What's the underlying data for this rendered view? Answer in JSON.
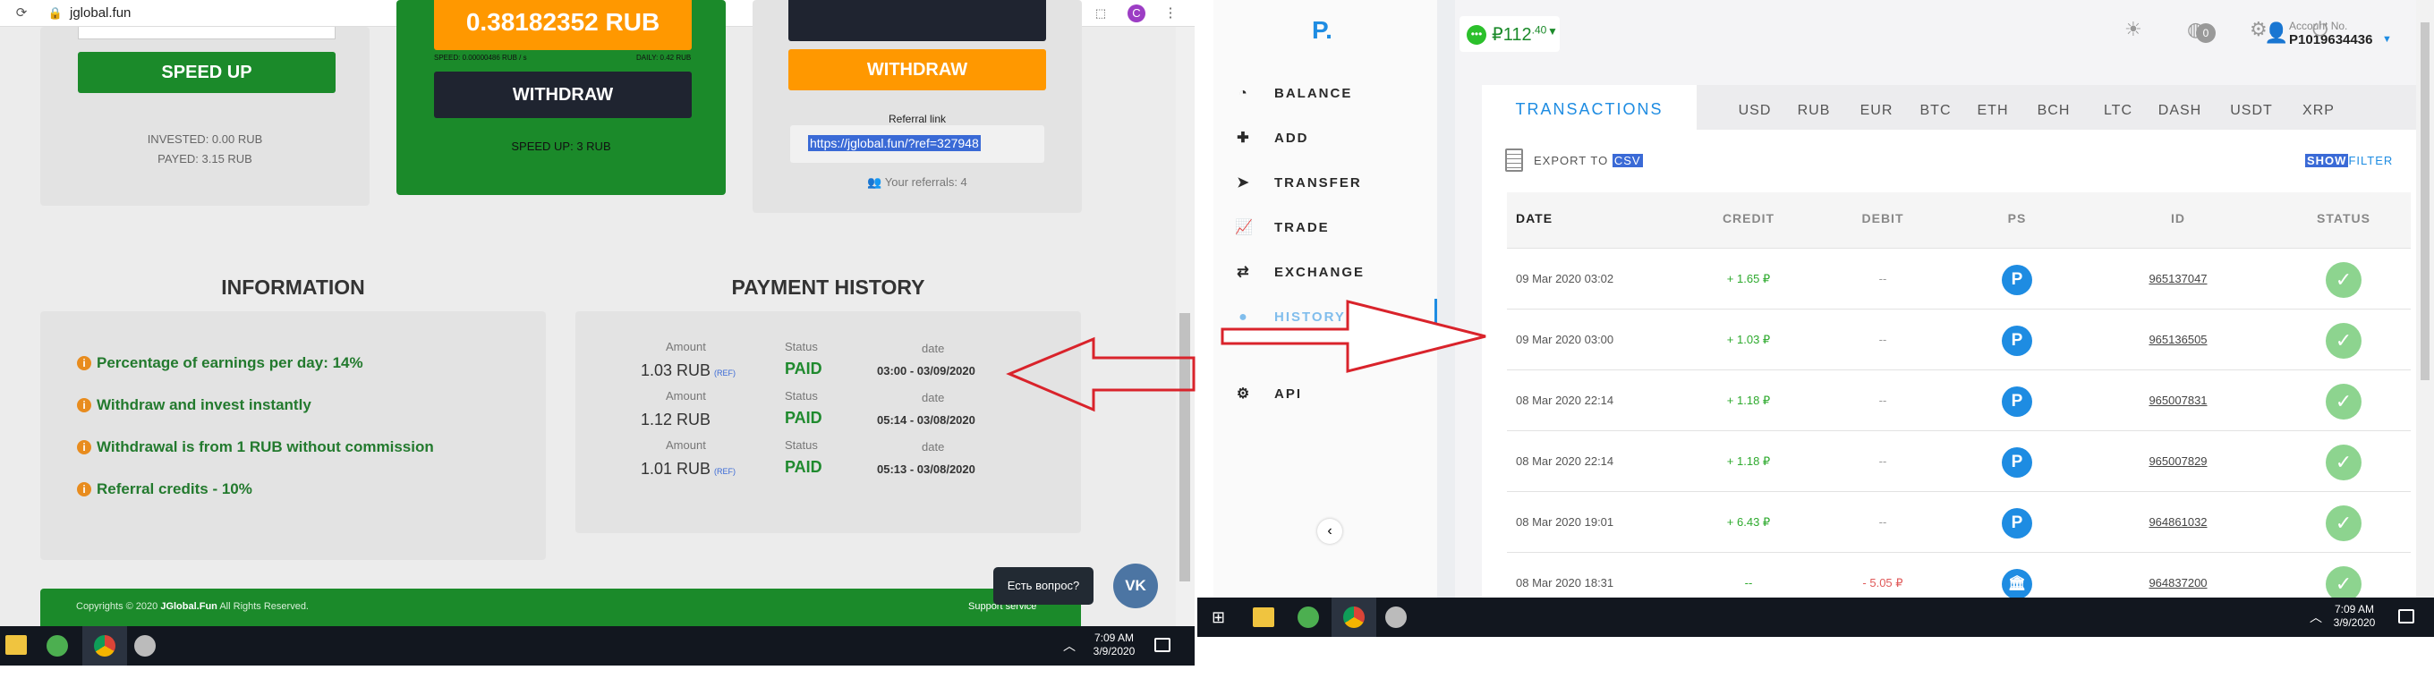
{
  "left": {
    "url": "jglobal.fun",
    "invest_card": {
      "speed_up_label": "SPEED UP",
      "invested": "INVESTED: 0.00 RUB",
      "payed": "PAYED: 3.15 RUB"
    },
    "green_card": {
      "balance": "0.38182352 RUB",
      "speed_line": "SPEED: 0.00000486 RUB / s",
      "daily_line": "DAILY: 0.42 RUB",
      "withdraw_label": "WITHDRAW",
      "speed_up_count": "SPEED UP: 3 RUB"
    },
    "ref_card": {
      "withdraw_label": "WITHDRAW",
      "referral_link_title": "Referral link",
      "referral_link": "https://jglobal.fun/?ref=327948",
      "referrals": "Your referrals: 4"
    },
    "information": {
      "title": "INFORMATION",
      "items": [
        "Percentage of earnings per day: 14%",
        "Withdraw and invest instantly",
        "Withdrawal is from 1 RUB without commission",
        "Referral credits - 10%"
      ]
    },
    "payment_history": {
      "title": "PAYMENT HISTORY",
      "amount_label": "Amount",
      "status_label": "Status",
      "date_label": "date",
      "rows": [
        {
          "amount": "1.03 RUB",
          "ref": "(REF)",
          "status": "PAID",
          "date": "03:00 - 03/09/2020"
        },
        {
          "amount": "1.12 RUB",
          "ref": "",
          "status": "PAID",
          "date": "05:14 - 03/08/2020"
        },
        {
          "amount": "1.01 RUB",
          "ref": "(REF)",
          "status": "PAID",
          "date": "05:13 - 03/08/2020"
        }
      ]
    },
    "footer": {
      "copyright_prefix": "Copyrights © 2020 ",
      "copyright_brand": "JGlobal.Fun",
      "copyright_suffix": " All Rights Reserved.",
      "support": "Support service"
    },
    "chat_bubble": "Есть вопрос?",
    "vk_label": "VK",
    "taskbar": {
      "time": "7:09 AM",
      "date": "3/9/2020"
    }
  },
  "right": {
    "logo": "P.",
    "balance_whole": "₽112",
    "balance_cents": ".40",
    "notification_count": "0",
    "account_label": "Account No.",
    "account_number": "P1019634436",
    "nav": [
      {
        "label": "BALANCE",
        "icon": "gauge-icon",
        "glyph": "◔"
      },
      {
        "label": "ADD",
        "icon": "plus-square-icon",
        "glyph": "✚"
      },
      {
        "label": "TRANSFER",
        "icon": "send-icon",
        "glyph": "➤"
      },
      {
        "label": "TRADE",
        "icon": "chart-icon",
        "glyph": "📈"
      },
      {
        "label": "EXCHANGE",
        "icon": "exchange-icon",
        "glyph": "⇄"
      },
      {
        "label": "HISTORY",
        "icon": "history-icon",
        "glyph": "●"
      },
      {
        "label": "API",
        "icon": "gears-icon",
        "glyph": "⚙"
      }
    ],
    "tabs": [
      "TRANSACTIONS",
      "USD",
      "RUB",
      "EUR",
      "BTC",
      "ETH",
      "BCH",
      "LTC",
      "DASH",
      "USDT",
      "XRP"
    ],
    "export_label": "EXPORT TO",
    "export_format": "CSV",
    "show_label": "SHOW",
    "filter_label": "FILTER",
    "columns": [
      "DATE",
      "CREDIT",
      "DEBIT",
      "PS",
      "ID",
      "STATUS"
    ],
    "rows": [
      {
        "date": "09 Mar 2020 03:02",
        "credit": "+ 1.65 ₽",
        "debit": "--",
        "ps": "P",
        "id": "965137047"
      },
      {
        "date": "09 Mar 2020 03:00",
        "credit": "+ 1.03 ₽",
        "debit": "--",
        "ps": "P",
        "id": "965136505"
      },
      {
        "date": "08 Mar 2020 22:14",
        "credit": "+ 1.18 ₽",
        "debit": "--",
        "ps": "P",
        "id": "965007831"
      },
      {
        "date": "08 Mar 2020 22:14",
        "credit": "+ 1.18 ₽",
        "debit": "--",
        "ps": "P",
        "id": "965007829"
      },
      {
        "date": "08 Mar 2020 19:01",
        "credit": "+ 6.43 ₽",
        "debit": "--",
        "ps": "P",
        "id": "964861032"
      },
      {
        "date": "08 Mar 2020 18:31",
        "credit": "--",
        "debit": "- 5.05 ₽",
        "ps": "bank",
        "id": "964837200"
      }
    ],
    "taskbar": {
      "time": "7:09 AM",
      "date": "3/9/2020"
    }
  },
  "colors": {
    "green": "#1b8a2a",
    "orange": "#ff9800",
    "dark": "#1f2430",
    "blue": "#1e8ce2",
    "red_arrow": "#d9232b",
    "success": "#8dd48f"
  }
}
